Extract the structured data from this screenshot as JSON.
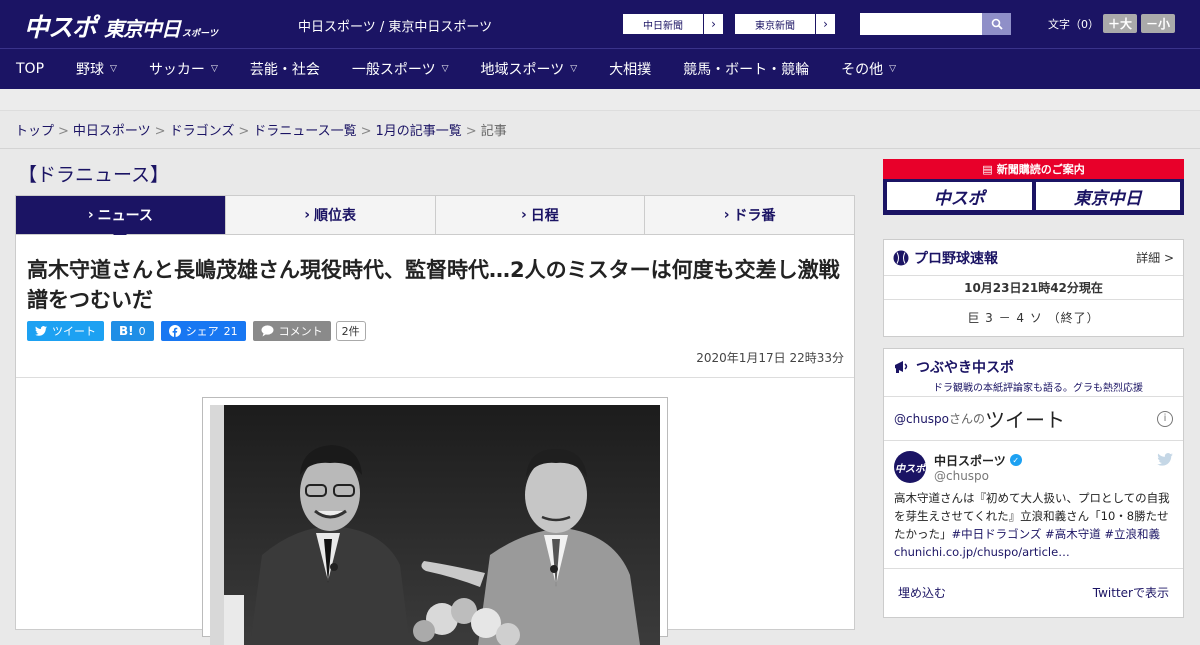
{
  "header": {
    "logo_main": "中スポ",
    "logo_tokyo": "東京中日",
    "logo_small": "スポーツ",
    "site_names": "中日スポーツ / 東京中日スポーツ",
    "paper_buttons": [
      "中日新聞",
      "東京新聞"
    ],
    "search": {
      "placeholder": "",
      "value": ""
    },
    "fontsize_label": "文字（0）",
    "font_plus": "＋大",
    "font_minus": "－小"
  },
  "nav": {
    "items": [
      {
        "label": "TOP",
        "has_menu": false
      },
      {
        "label": "野球",
        "has_menu": true
      },
      {
        "label": "サッカー",
        "has_menu": true
      },
      {
        "label": "芸能・社会",
        "has_menu": false
      },
      {
        "label": "一般スポーツ",
        "has_menu": true
      },
      {
        "label": "地域スポーツ",
        "has_menu": true
      },
      {
        "label": "大相撲",
        "has_menu": false
      },
      {
        "label": "競馬・ボート・競輪",
        "has_menu": false
      },
      {
        "label": "その他",
        "has_menu": true
      }
    ]
  },
  "breadcrumb": {
    "links": [
      "トップ",
      "中日スポーツ",
      "ドラゴンズ",
      "ドラニュース一覧",
      "1月の記事一覧"
    ],
    "current": "記事",
    "separator": ">"
  },
  "section_title": "【ドラニュース】",
  "tabs": [
    {
      "label": "ニュース",
      "active": true
    },
    {
      "label": "順位表",
      "active": false
    },
    {
      "label": "日程",
      "active": false
    },
    {
      "label": "ドラ番",
      "active": false
    }
  ],
  "article": {
    "headline": "高木守道さんと長嶋茂雄さん現役時代、監督時代…2人のミスターは何度も交差し激戦譜をつむいだ",
    "share": {
      "tweet_label": "ツイート",
      "hatena_label": "B!",
      "hatena_count": "0",
      "fb_label": "シェア",
      "fb_count": "21",
      "comment_label": "コメント",
      "comment_count": "2件"
    },
    "date": "2020年1月17日 22時33分"
  },
  "sidebar": {
    "promo": {
      "title": "新聞購読のご案内",
      "logo1": "中スポ",
      "logo2": "東京中日"
    },
    "baseball": {
      "title": "プロ野球速報",
      "detail": "詳細 >",
      "time": "10月23日21時42分現在",
      "score": "巨 3 － 4 ソ （終了）"
    },
    "tweets": {
      "title": "つぶやき中スポ",
      "subtitle": "ドラ観戦の本紙評論家も語る。グラも熱烈応援",
      "handle": "@chuspo",
      "handle_suffix": "さんの",
      "handle_tweet": "ツイート",
      "user_name": "中日スポーツ",
      "user_handle": "@chuspo",
      "text_plain": "高木守道さんは『初めて大人扱い、プロとしての自我を芽生えさせてくれた』立浪和義さん「10・8勝たせたかった」",
      "text_links": "#中日ドラゴンズ #高木守道 #立浪和義chunichi.co.jp/chuspo/article…",
      "embed": "埋め込む",
      "view_on": "Twitterで表示"
    }
  },
  "colors": {
    "brand": "#1b1464",
    "accent_red": "#e8002a",
    "twitter": "#1da1f2"
  }
}
